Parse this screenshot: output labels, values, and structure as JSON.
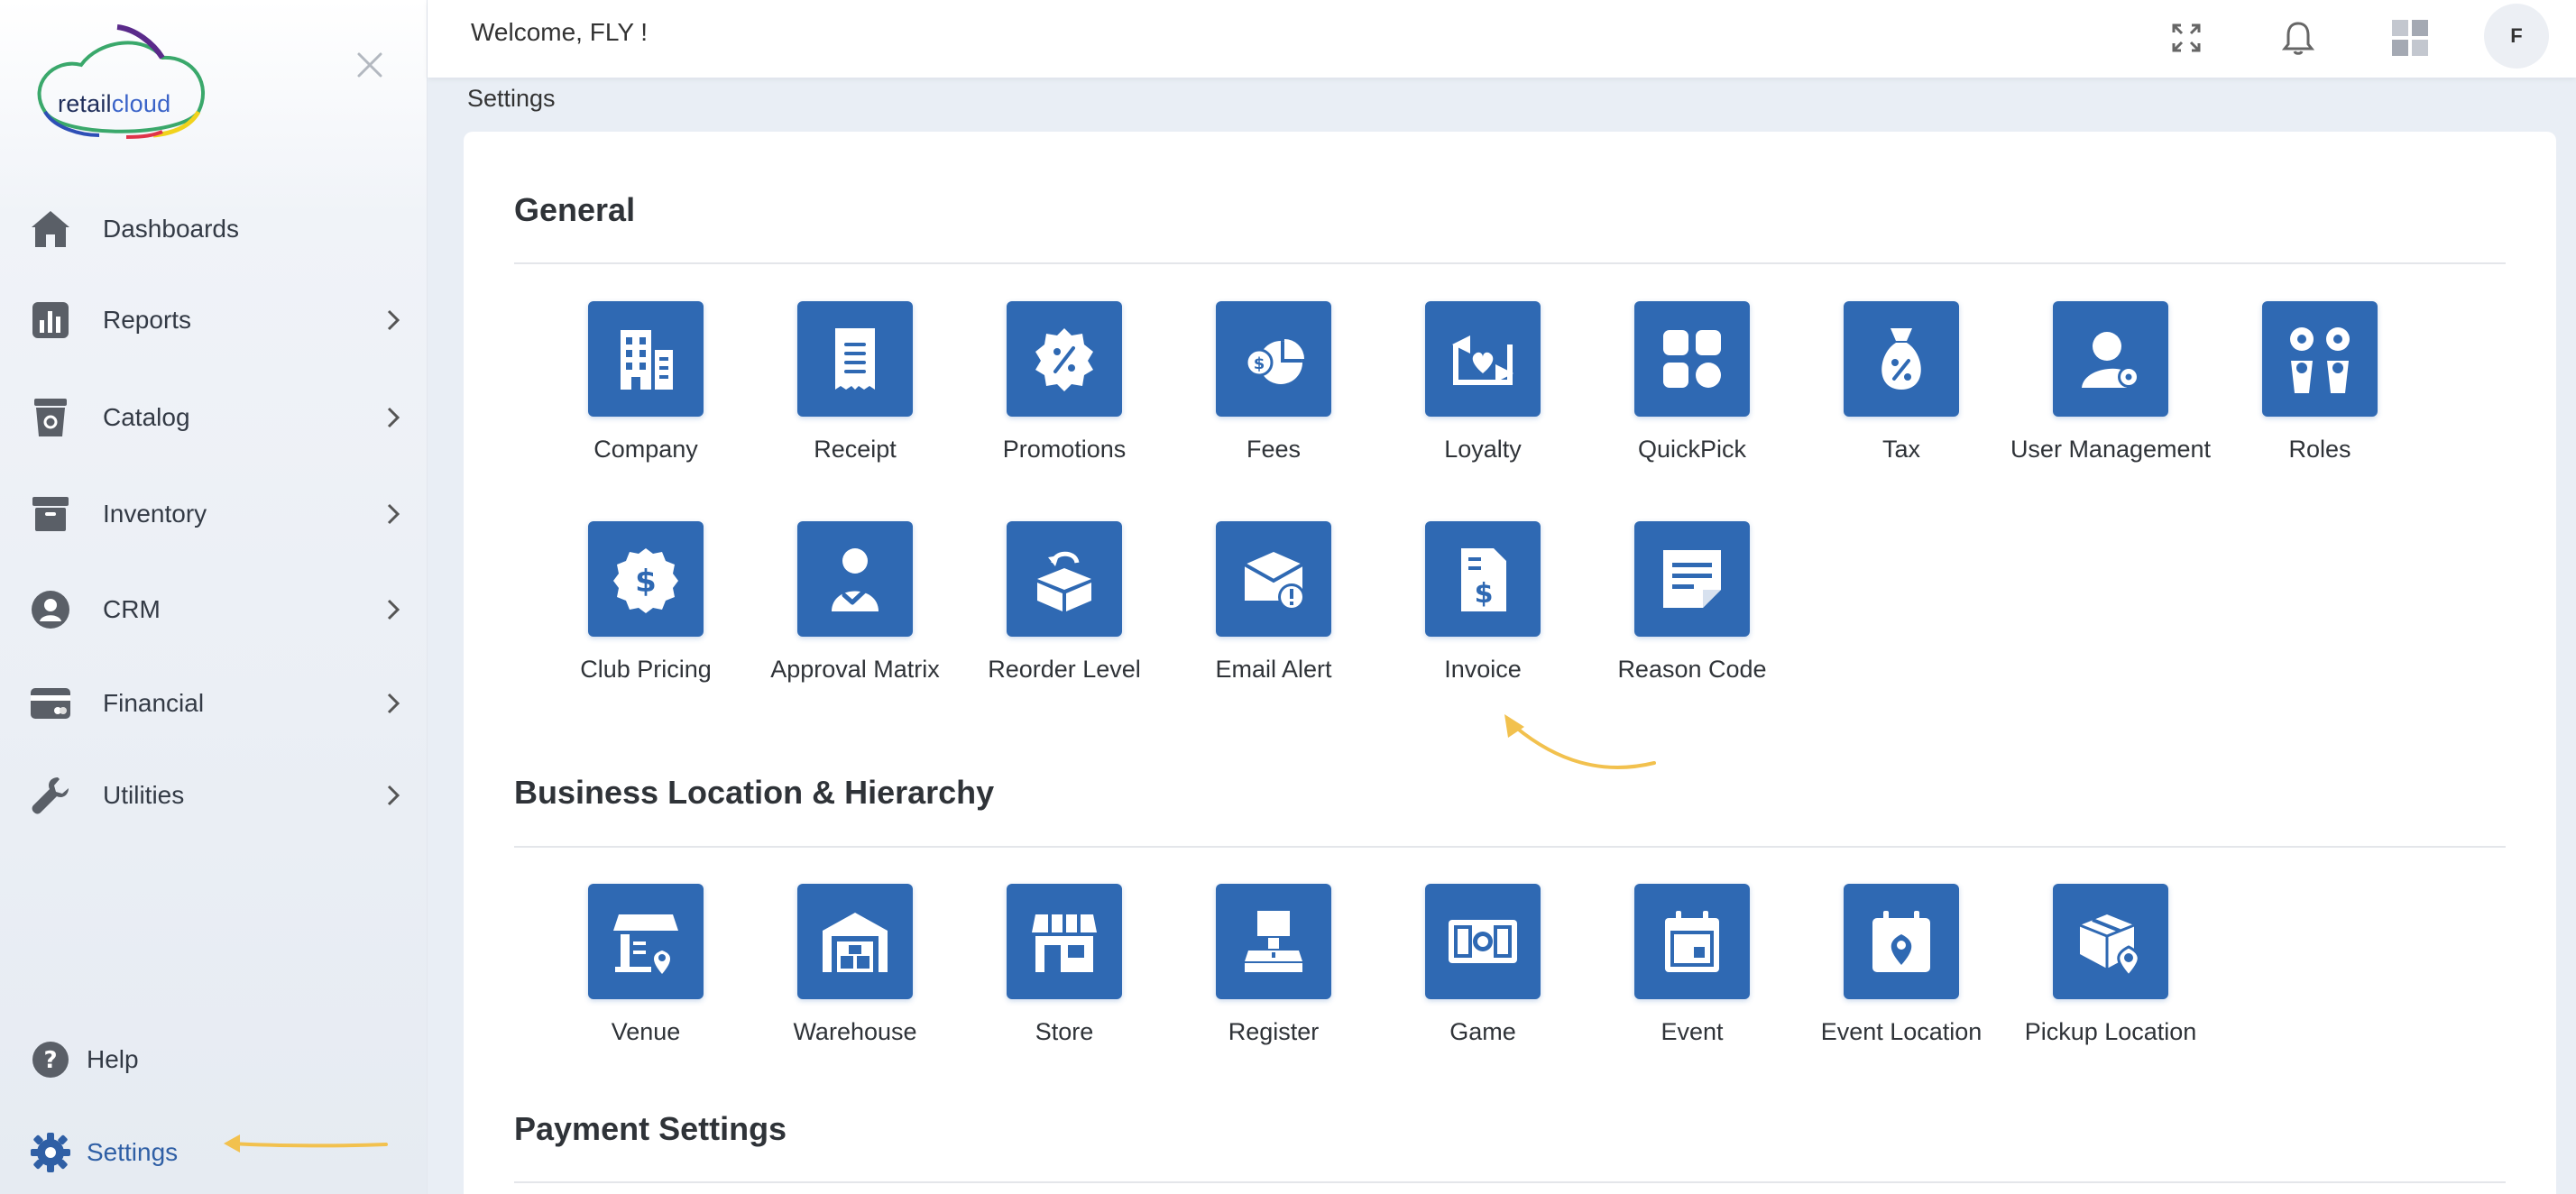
{
  "brand": {
    "logo_text_a": "retail",
    "logo_text_b": "cloud"
  },
  "sidebar": {
    "items": [
      {
        "label": "Dashboards",
        "icon": "home-icon"
      },
      {
        "label": "Reports",
        "icon": "bar-chart-icon"
      },
      {
        "label": "Catalog",
        "icon": "catalog-icon"
      },
      {
        "label": "Inventory",
        "icon": "archive-icon"
      },
      {
        "label": "CRM",
        "icon": "crm-icon"
      },
      {
        "label": "Financial",
        "icon": "credit-card-icon"
      },
      {
        "label": "Utilities",
        "icon": "wrench-icon"
      }
    ],
    "help_label": "Help",
    "settings_label": "Settings"
  },
  "header": {
    "welcome": "Welcome, FLY !",
    "avatar_initial": "F"
  },
  "breadcrumb": "Settings",
  "sections": {
    "general": {
      "title": "General",
      "tiles": [
        "Company",
        "Receipt",
        "Promotions",
        "Fees",
        "Loyalty",
        "QuickPick",
        "Tax",
        "User Management",
        "Roles",
        "Club Pricing",
        "Approval Matrix",
        "Reorder Level",
        "Email Alert",
        "Invoice",
        "Reason Code"
      ]
    },
    "business": {
      "title": "Business Location & Hierarchy",
      "tiles": [
        "Venue",
        "Warehouse",
        "Store",
        "Register",
        "Game",
        "Event",
        "Event Location",
        "Pickup Location"
      ]
    },
    "payment": {
      "title": "Payment Settings"
    }
  },
  "colors": {
    "accent": "#2f69b3",
    "arrow": "#f2c14e",
    "settings_active": "#2f5fa5"
  }
}
